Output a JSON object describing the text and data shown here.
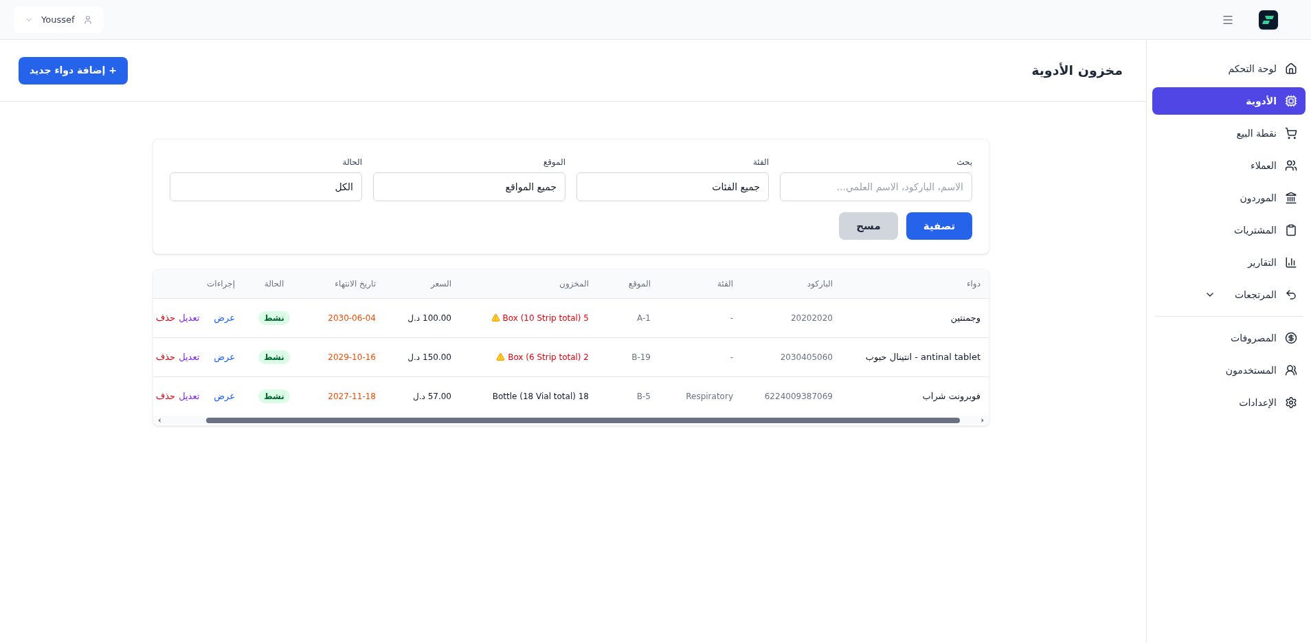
{
  "topbar": {
    "user": "Youssef"
  },
  "sidebar": {
    "items": [
      {
        "label": "لوحة التحكم",
        "selected": false
      },
      {
        "label": "الأدوية",
        "selected": true
      },
      {
        "label": "نقطة البيع",
        "selected": false
      },
      {
        "label": "العملاء",
        "selected": false
      },
      {
        "label": "الموردون",
        "selected": false
      },
      {
        "label": "المشتريات",
        "selected": false
      },
      {
        "label": "التقارير",
        "selected": false
      },
      {
        "label": "المرتجعات",
        "selected": false,
        "expanded": false
      }
    ],
    "secondary_items": [
      {
        "label": "المصروفات",
        "selected": false
      },
      {
        "label": "المستخدمون",
        "selected": false
      },
      {
        "label": "الإعدادات",
        "selected": false
      }
    ]
  },
  "page": {
    "title": "مخزون الأدوية",
    "add_button": "+ إضافة دواء جديد"
  },
  "filters": {
    "fields": [
      {
        "label": "بحث",
        "placeholder": "الاسم، الباركود، الاسم العلمي..."
      },
      {
        "label": "الفئة",
        "value": "جميع الفئات"
      },
      {
        "label": "الموقع",
        "value": "جميع المواقع"
      },
      {
        "label": "الحالة",
        "value": "الكل"
      }
    ],
    "apply_button": "تصفية",
    "clear_button": "مسح"
  },
  "table": {
    "columns": [
      "دواء",
      "الباركود",
      "الفئة",
      "الموقع",
      "المخزون",
      "السعر",
      "تاريخ الانتهاء",
      "الحالة",
      "إجراءات"
    ],
    "rows": [
      {
        "name": "وجمنتين",
        "barcode": "20202020",
        "category": "-",
        "location": "A-1",
        "stock": "Box (10 Strip total) 5",
        "low_stock": true,
        "price": "100.00 د.ل",
        "expiry": "2030-06-04",
        "status": "نشط",
        "actions": [
          "عرض",
          "تعديل",
          "حذف"
        ]
      },
      {
        "name": "antinal tablet - انتينال حبوب",
        "barcode": "2030405060",
        "category": "-",
        "location": "B-19",
        "stock": "Box (6 Strip total) 2",
        "low_stock": true,
        "price": "150.00 د.ل",
        "expiry": "2029-10-16",
        "status": "نشط",
        "actions": [
          "عرض",
          "تعديل",
          "حذف"
        ]
      },
      {
        "name": "فوبرونت شراب",
        "barcode": "6224009387069",
        "category": "Respiratory",
        "location": "B-5",
        "stock": "Bottle (18 Vial total) 18",
        "low_stock": false,
        "price": "57.00 د.ل",
        "expiry": "2027-11-18",
        "status": "نشط",
        "actions": [
          "عرض",
          "تعديل",
          "حذف"
        ]
      }
    ]
  }
}
